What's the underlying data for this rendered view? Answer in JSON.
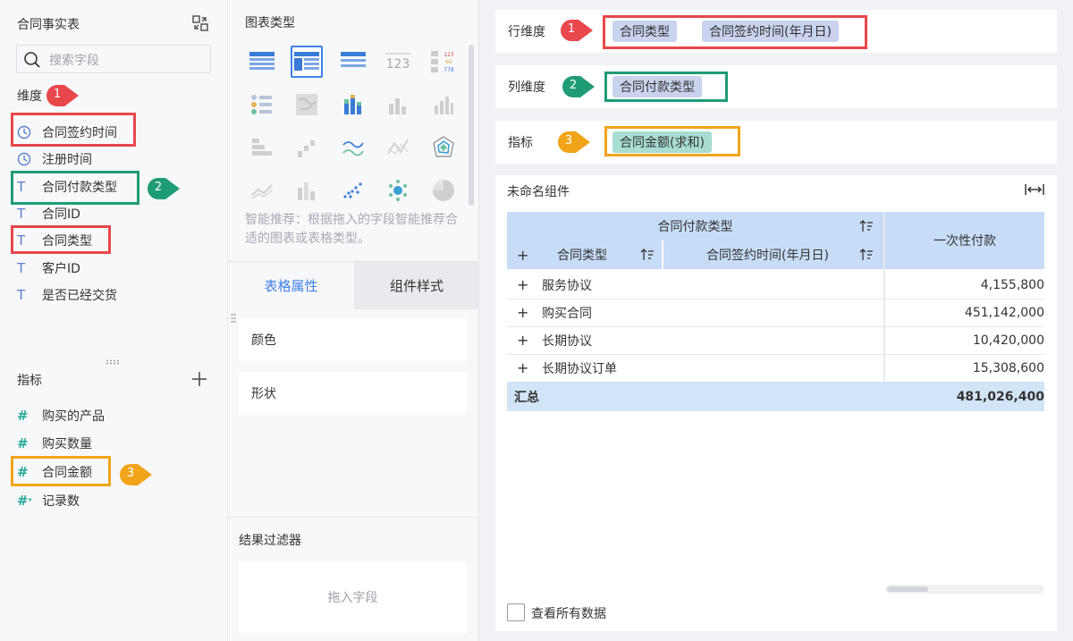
{
  "left": {
    "title": "合同事实表",
    "search_placeholder": "搜索字段",
    "dimension_label": "维度",
    "measure_label": "指标",
    "dimensions": [
      {
        "icon": "clock-icon",
        "label": "合同签约时间"
      },
      {
        "icon": "clock-icon",
        "label": "注册时间"
      },
      {
        "icon": "text-type-icon",
        "label": "合同付款类型"
      },
      {
        "icon": "text-type-icon",
        "label": "合同ID"
      },
      {
        "icon": "text-type-icon",
        "label": "合同类型"
      },
      {
        "icon": "text-type-icon",
        "label": "客户ID"
      },
      {
        "icon": "text-type-icon",
        "label": "是否已经交货"
      }
    ],
    "measures": [
      {
        "icon": "hash-icon",
        "label": "购买的产品"
      },
      {
        "icon": "hash-icon",
        "label": "购买数量"
      },
      {
        "icon": "hash-icon",
        "label": "合同金额"
      },
      {
        "icon": "hash-star-icon",
        "label": "记录数"
      }
    ]
  },
  "markers": {
    "m1": "1",
    "m2": "2",
    "m3": "3"
  },
  "middle": {
    "chart_type_title": "图表类型",
    "tip": "智能推荐：根据拖入的字段智能推荐合适的图表或表格类型。",
    "tab_table_props": "表格属性",
    "tab_component_style": "组件样式",
    "prop_color": "颜色",
    "prop_shape": "形状",
    "filter_title": "结果过滤器",
    "filter_drop": "拖入字段"
  },
  "shelves": {
    "row_label": "行维度",
    "row_pills": [
      "合同类型",
      "合同签约时间(年月日)"
    ],
    "col_label": "列维度",
    "col_pills": [
      "合同付款类型"
    ],
    "measure_label": "指标",
    "measure_pills": [
      "合同金额(求和)"
    ]
  },
  "widget": {
    "title": "未命名组件",
    "header_col_dim": "合同付款类型",
    "header_row1": "合同类型",
    "header_row2": "合同签约时间(年月日)",
    "header_value": "一次性付款",
    "rows": [
      {
        "label": "服务协议",
        "value": "4,155,800"
      },
      {
        "label": "购买合同",
        "value": "451,142,000"
      },
      {
        "label": "长期协议",
        "value": "10,420,000"
      },
      {
        "label": "长期协议订单",
        "value": "15,308,600"
      }
    ],
    "total_label": "汇总",
    "total_value": "481,026,400",
    "view_all": "查看所有数据"
  },
  "colors": {
    "accent": "#3f7fe8",
    "callout_red": "#e8474b",
    "callout_green": "#1f9c76",
    "callout_orange": "#f1a419"
  }
}
